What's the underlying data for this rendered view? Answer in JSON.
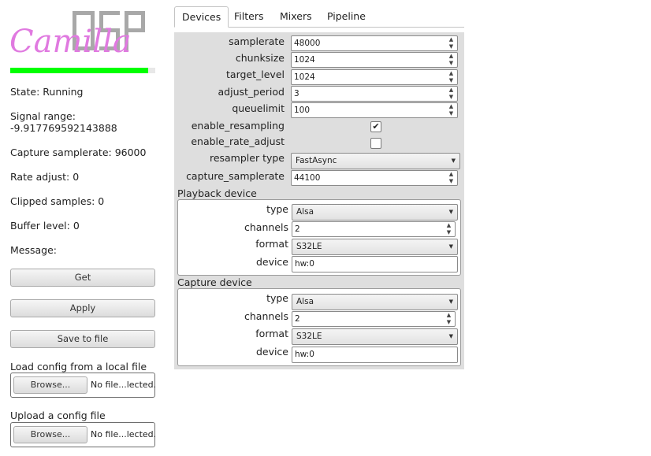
{
  "sidebar": {
    "logo": {
      "script_text": "Camilla",
      "block_text": "DSP",
      "script_color": "#e07ae0",
      "block_color": "#9a9a9a"
    },
    "level": {
      "fraction": 0.95,
      "color": "#00ff00"
    },
    "state": "State: Running",
    "signal_range_label": "Signal range:",
    "signal_range_value": "-9.917769592143888",
    "capture_samplerate": "Capture samplerate: 96000",
    "rate_adjust": "Rate adjust: 0",
    "clipped_samples": "Clipped samples: 0",
    "buffer_level": "Buffer level: 0",
    "message": "Message:",
    "get_label": "Get",
    "apply_label": "Apply",
    "save_label": "Save to file",
    "load_local_label": "Load config from a local file",
    "upload_label": "Upload a config file",
    "browse_label": "Browse...",
    "no_file_label": "No file...lected."
  },
  "tabs": [
    "Devices",
    "Filters",
    "Mixers",
    "Pipeline"
  ],
  "devices": {
    "samplerate": {
      "label": "samplerate",
      "value": "48000"
    },
    "chunksize": {
      "label": "chunksize",
      "value": "1024"
    },
    "target_level": {
      "label": "target_level",
      "value": "1024"
    },
    "adjust_period": {
      "label": "adjust_period",
      "value": "3"
    },
    "queuelimit": {
      "label": "queuelimit",
      "value": "100"
    },
    "enable_resampling": {
      "label": "enable_resampling",
      "checked": true
    },
    "enable_rate_adjust": {
      "label": "enable_rate_adjust",
      "checked": false
    },
    "resampler_type": {
      "label": "resampler type",
      "value": "FastAsync"
    },
    "capture_samplerate": {
      "label": "capture_samplerate",
      "value": "44100"
    }
  },
  "playback": {
    "title": "Playback device",
    "type_label": "type",
    "type_value": "Alsa",
    "channels_label": "channels",
    "channels_value": "2",
    "format_label": "format",
    "format_value": "S32LE",
    "device_label": "device",
    "device_value": "hw:0"
  },
  "capture": {
    "title": "Capture device",
    "type_label": "type",
    "type_value": "Alsa",
    "channels_label": "channels",
    "channels_value": "2",
    "format_label": "format",
    "format_value": "S32LE",
    "device_label": "device",
    "device_value": "hw:0"
  },
  "icons": {
    "spin_up": "▲",
    "spin_down": "▼",
    "dropdown": "▼",
    "check": "✔"
  }
}
